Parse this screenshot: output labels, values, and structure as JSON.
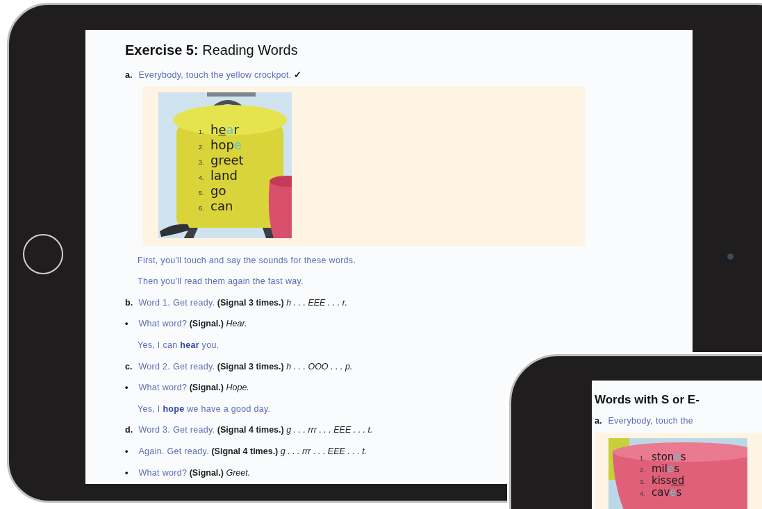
{
  "main_tablet": {
    "title_label": "Exercise 5:",
    "title": "Reading Words",
    "intro": {
      "marker": "a.",
      "segments": [
        {
          "kind": "say",
          "text": "Everybody, touch the yellow crockpot."
        },
        {
          "kind": "check",
          "text": "✓"
        }
      ]
    },
    "word_list": [
      {
        "number": "1.",
        "parts": [
          {
            "kind": "plain",
            "text": "h"
          },
          {
            "kind": "underline",
            "text": "e"
          },
          {
            "kind": "accent",
            "text": "a"
          },
          {
            "kind": "plain",
            "text": "r"
          }
        ]
      },
      {
        "number": "2.",
        "parts": [
          {
            "kind": "plain",
            "text": "hop"
          },
          {
            "kind": "accent",
            "text": "e"
          }
        ]
      },
      {
        "number": "3.",
        "parts": [
          {
            "kind": "plain",
            "text": "greet"
          }
        ]
      },
      {
        "number": "4.",
        "parts": [
          {
            "kind": "plain",
            "text": "land"
          }
        ]
      },
      {
        "number": "5.",
        "parts": [
          {
            "kind": "plain",
            "text": "go"
          }
        ]
      },
      {
        "number": "6.",
        "parts": [
          {
            "kind": "plain",
            "text": "can"
          }
        ]
      }
    ],
    "lines": [
      {
        "segments": [
          {
            "kind": "say",
            "text": "First, you'll touch and say the sounds for these words."
          }
        ]
      },
      {
        "segments": [
          {
            "kind": "say",
            "text": "Then you'll read them again the fast way."
          }
        ]
      },
      {
        "marker": "b.",
        "segments": [
          {
            "kind": "say",
            "text": "Word 1. Get ready."
          },
          {
            "kind": "do",
            "text": "(Signal 3 times.)"
          },
          {
            "kind": "response",
            "text": "h . . . EEE . . . r."
          }
        ]
      },
      {
        "marker": "•",
        "segments": [
          {
            "kind": "say",
            "text": "What word?"
          },
          {
            "kind": "do",
            "text": "(Signal.)"
          },
          {
            "kind": "response",
            "text": "Hear."
          }
        ]
      },
      {
        "segments": [
          {
            "kind": "say",
            "text": "Yes, I can **hear** you."
          }
        ]
      },
      {
        "marker": "c.",
        "segments": [
          {
            "kind": "say",
            "text": "Word 2. Get ready."
          },
          {
            "kind": "do",
            "text": "(Signal 3 times.)"
          },
          {
            "kind": "response",
            "text": "h . . . OOO . . . p."
          }
        ]
      },
      {
        "marker": "•",
        "segments": [
          {
            "kind": "say",
            "text": "What word?"
          },
          {
            "kind": "do",
            "text": "(Signal.)"
          },
          {
            "kind": "response",
            "text": "Hope."
          }
        ]
      },
      {
        "segments": [
          {
            "kind": "say",
            "text": "Yes, I **hope** we have a good day."
          }
        ]
      },
      {
        "marker": "d.",
        "segments": [
          {
            "kind": "say",
            "text": "Word 3. Get ready."
          },
          {
            "kind": "do",
            "text": "(Signal 4 times.)"
          },
          {
            "kind": "response",
            "text": "g . . . rrr . . . EEE . . . t."
          }
        ]
      },
      {
        "marker": "•",
        "segments": [
          {
            "kind": "say",
            "text": "Again. Get ready."
          },
          {
            "kind": "do",
            "text": "(Signal 4 times.)"
          },
          {
            "kind": "response",
            "text": "g . . . rrr . . . EEE . . . t."
          }
        ]
      },
      {
        "marker": "•",
        "segments": [
          {
            "kind": "say",
            "text": "What word?"
          },
          {
            "kind": "do",
            "text": "(Signal.)"
          },
          {
            "kind": "response",
            "text": "Greet."
          }
        ]
      }
    ]
  },
  "second_tablet": {
    "title": "Words with S or E-",
    "intro": {
      "marker": "a.",
      "segments": [
        {
          "kind": "say",
          "text": "Everybody, touch the"
        }
      ]
    },
    "word_list": [
      {
        "number": "1.",
        "parts": [
          {
            "kind": "plain",
            "text": "ston"
          },
          {
            "kind": "accent",
            "text": "e"
          },
          {
            "kind": "plain",
            "text": "s"
          }
        ]
      },
      {
        "number": "2.",
        "parts": [
          {
            "kind": "plain",
            "text": "mil"
          },
          {
            "kind": "accent",
            "text": "e"
          },
          {
            "kind": "plain",
            "text": "s"
          }
        ]
      },
      {
        "number": "3.",
        "parts": [
          {
            "kind": "plain",
            "text": "kiss"
          },
          {
            "kind": "underline",
            "text": "ed"
          }
        ]
      },
      {
        "number": "4.",
        "parts": [
          {
            "kind": "plain",
            "text": "cav"
          },
          {
            "kind": "accent",
            "text": "e"
          },
          {
            "kind": "plain",
            "text": "s"
          }
        ]
      }
    ]
  }
}
